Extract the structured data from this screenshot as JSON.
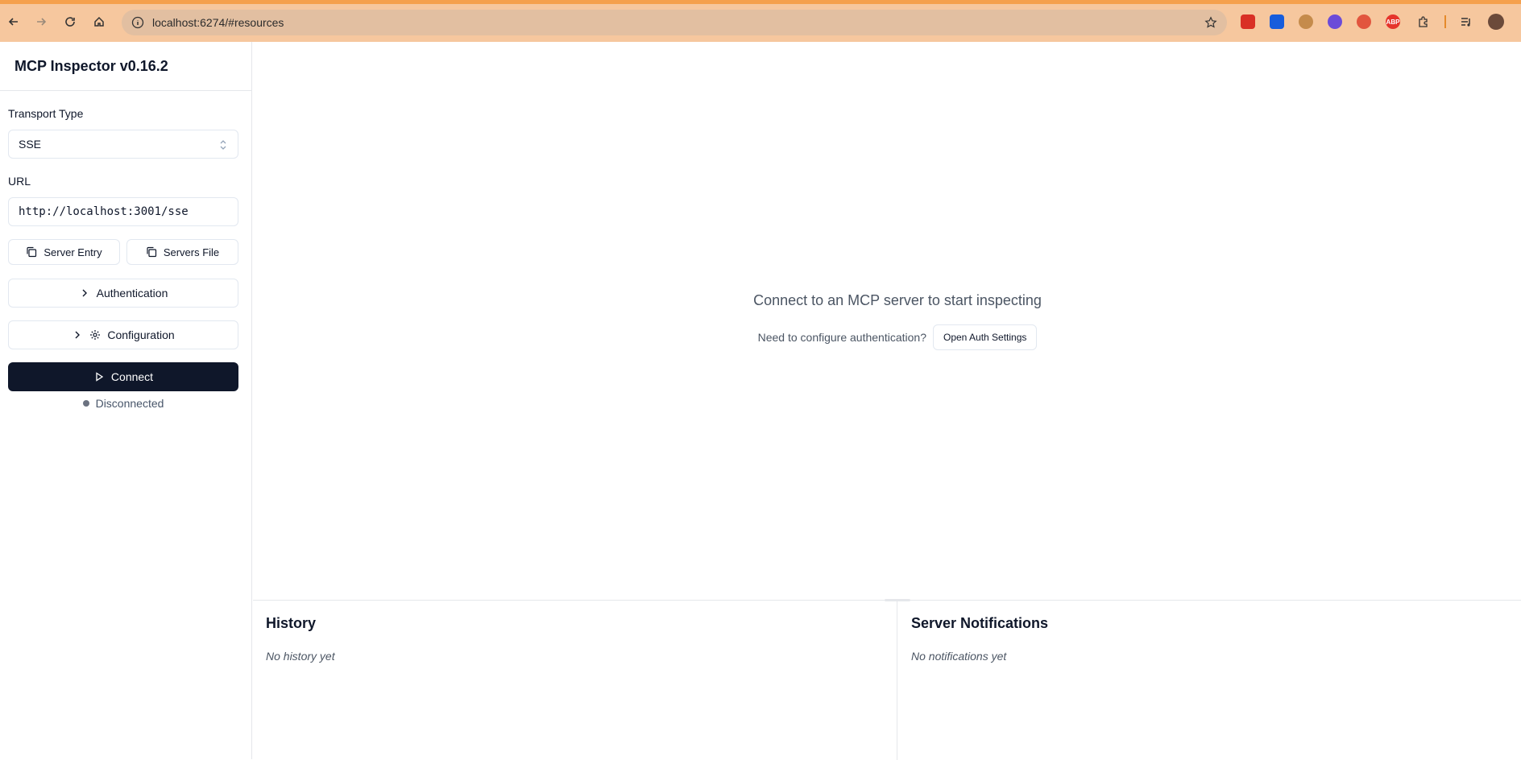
{
  "browser": {
    "url": "localhost:6274/#resources",
    "colors": {
      "accent": "#f5a04d",
      "toolbar": "#f6c79e"
    },
    "extensions": [
      {
        "name": "ublock-icon",
        "color": "#d93025",
        "glyph": ""
      },
      {
        "name": "bitwarden-icon",
        "color": "#175ddc",
        "glyph": ""
      },
      {
        "name": "cookie-icon",
        "color": "#c58b4b",
        "glyph": ""
      },
      {
        "name": "blocker-icon",
        "color": "#6b4bd8",
        "glyph": ""
      },
      {
        "name": "s-icon",
        "color": "#e2553e",
        "glyph": ""
      },
      {
        "name": "adblock-icon",
        "color": "#e5342b",
        "glyph": "ABP"
      }
    ]
  },
  "app": {
    "title": "MCP Inspector v0.16.2"
  },
  "sidebar": {
    "transport_label": "Transport Type",
    "transport_value": "SSE",
    "url_label": "URL",
    "url_value": "http://localhost:3001/sse",
    "server_entry_label": "Server Entry",
    "servers_file_label": "Servers File",
    "authentication_label": "Authentication",
    "configuration_label": "Configuration",
    "connect_label": "Connect",
    "status_text": "Disconnected",
    "connect_color": "#0f172a"
  },
  "main": {
    "empty_title": "Connect to an MCP server to start inspecting",
    "auth_prompt": "Need to configure authentication?",
    "auth_button": "Open Auth Settings"
  },
  "bottom": {
    "history_title": "History",
    "history_empty": "No history yet",
    "notifications_title": "Server Notifications",
    "notifications_empty": "No notifications yet"
  }
}
